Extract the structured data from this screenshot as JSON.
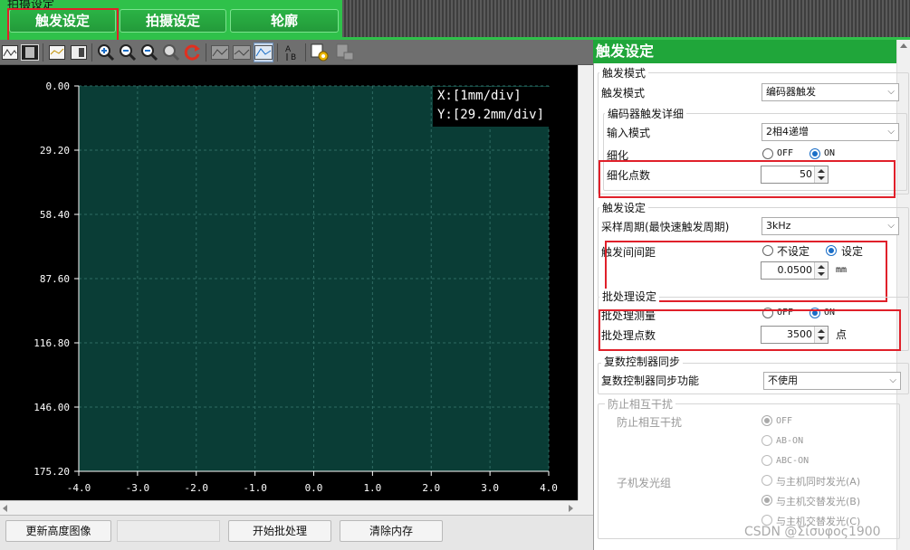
{
  "top": {
    "title": "拍摄设定",
    "tabs": [
      "触发设定",
      "拍摄设定",
      "轮廓"
    ]
  },
  "plot": {
    "scale_x": "X:[1mm/div]",
    "scale_y": "Y:[29.2mm/div]"
  },
  "chart_data": {
    "type": "line",
    "series": [],
    "x_ticks": [
      "-4.0",
      "-3.0",
      "-2.0",
      "-1.0",
      "0.0",
      "1.0",
      "2.0",
      "3.0",
      "4.0"
    ],
    "y_ticks": [
      "0.00",
      "29.20",
      "58.40",
      "87.60",
      "116.80",
      "146.00",
      "175.20"
    ],
    "xlim": [
      -4.0,
      4.0
    ],
    "ylim": [
      175.2,
      0.0
    ],
    "grid": true,
    "colors": {
      "background": "#0a3d36",
      "grid": "#2f6b63"
    }
  },
  "bottom": {
    "btn1": "更新高度图像",
    "btn2": "开始批处理",
    "btn3": "清除内存"
  },
  "panel": {
    "title": "触发设定",
    "trigger_mode_group": "触发模式",
    "trigger_mode_label": "触发模式",
    "trigger_mode_value": "编码器触发",
    "encoder_group": "编码器触发详细",
    "input_mode_label": "输入模式",
    "input_mode_value": "2相4递增",
    "refine_label": "细化",
    "refine_off": "OFF",
    "refine_on": "ON",
    "refine_points_label": "细化点数",
    "refine_points_value": "50",
    "trigger_group": "触发设定",
    "sampling_label": "采样周期(最快速触发周期)",
    "sampling_value": "3kHz",
    "interval_label": "触发间间距",
    "interval_opt_none": "不设定",
    "interval_opt_set": "设定",
    "interval_value": "0.0500",
    "interval_unit": "mm",
    "batch_group": "批处理设定",
    "batch_measure_label": "批处理测量",
    "batch_off": "OFF",
    "batch_on": "ON",
    "batch_points_label": "批处理点数",
    "batch_points_value": "3500",
    "batch_points_unit": "点",
    "sync_group": "复数控制器同步",
    "sync_label": "复数控制器同步功能",
    "sync_value": "不使用",
    "interference_group": "防止相互干扰",
    "interference_label": "防止相互干扰",
    "slave_label": "子机发光组",
    "opt_off": "OFF",
    "opt_ab": "AB-ON",
    "opt_abc": "ABC-ON",
    "opt_sync": "与主机同时发光(A)",
    "opt_alt_b": "与主机交替发光(B)",
    "opt_alt_c": "与主机交替发光(C)"
  },
  "watermark": "CSDN @Σίσυφος1900"
}
